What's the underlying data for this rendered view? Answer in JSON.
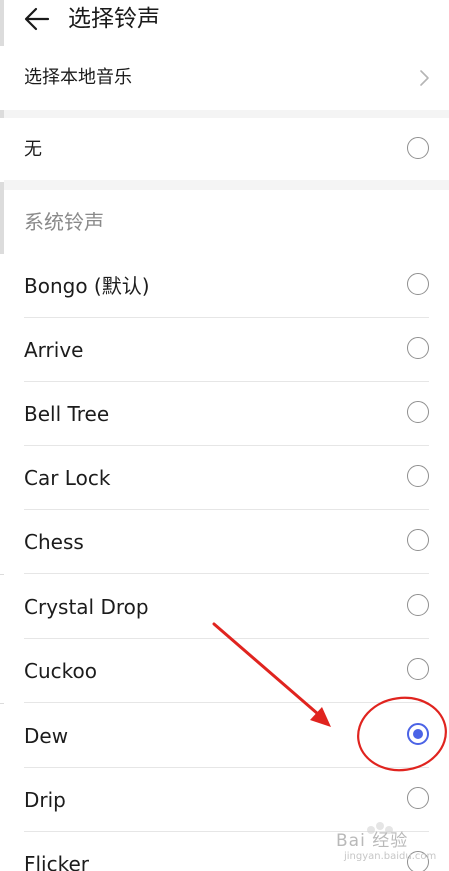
{
  "header": {
    "title": "选择铃声",
    "back_icon": "back-arrow-icon"
  },
  "local_music": {
    "label": "选择本地音乐",
    "icon": "chevron-right-icon"
  },
  "none_option": {
    "label": "无"
  },
  "section": {
    "title": "系统铃声"
  },
  "ringtones": [
    {
      "label": "Bongo (默认)",
      "selected": false
    },
    {
      "label": "Arrive",
      "selected": false
    },
    {
      "label": "Bell Tree",
      "selected": false
    },
    {
      "label": "Car Lock",
      "selected": false
    },
    {
      "label": "Chess",
      "selected": false
    },
    {
      "label": "Crystal Drop",
      "selected": false
    },
    {
      "label": "Cuckoo",
      "selected": false
    },
    {
      "label": "Dew",
      "selected": true
    },
    {
      "label": "Drip",
      "selected": false
    },
    {
      "label": "Flicker",
      "selected": false
    }
  ],
  "colors": {
    "accent": "#4b63e6",
    "annotation": "#e0241f"
  },
  "watermark": {
    "text": "Bai 经验",
    "sub": "jingyan.baidu.com"
  }
}
